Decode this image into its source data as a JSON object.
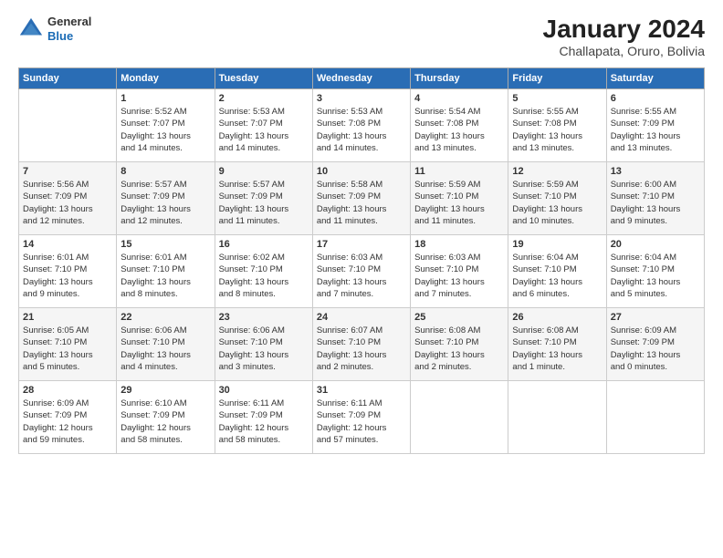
{
  "header": {
    "logo": {
      "general": "General",
      "blue": "Blue"
    },
    "title": "January 2024",
    "subtitle": "Challapata, Oruro, Bolivia"
  },
  "columns": [
    "Sunday",
    "Monday",
    "Tuesday",
    "Wednesday",
    "Thursday",
    "Friday",
    "Saturday"
  ],
  "weeks": [
    [
      {
        "day": "",
        "info": ""
      },
      {
        "day": "1",
        "info": "Sunrise: 5:52 AM\nSunset: 7:07 PM\nDaylight: 13 hours\nand 14 minutes."
      },
      {
        "day": "2",
        "info": "Sunrise: 5:53 AM\nSunset: 7:07 PM\nDaylight: 13 hours\nand 14 minutes."
      },
      {
        "day": "3",
        "info": "Sunrise: 5:53 AM\nSunset: 7:08 PM\nDaylight: 13 hours\nand 14 minutes."
      },
      {
        "day": "4",
        "info": "Sunrise: 5:54 AM\nSunset: 7:08 PM\nDaylight: 13 hours\nand 13 minutes."
      },
      {
        "day": "5",
        "info": "Sunrise: 5:55 AM\nSunset: 7:08 PM\nDaylight: 13 hours\nand 13 minutes."
      },
      {
        "day": "6",
        "info": "Sunrise: 5:55 AM\nSunset: 7:09 PM\nDaylight: 13 hours\nand 13 minutes."
      }
    ],
    [
      {
        "day": "7",
        "info": "Sunrise: 5:56 AM\nSunset: 7:09 PM\nDaylight: 13 hours\nand 12 minutes."
      },
      {
        "day": "8",
        "info": "Sunrise: 5:57 AM\nSunset: 7:09 PM\nDaylight: 13 hours\nand 12 minutes."
      },
      {
        "day": "9",
        "info": "Sunrise: 5:57 AM\nSunset: 7:09 PM\nDaylight: 13 hours\nand 11 minutes."
      },
      {
        "day": "10",
        "info": "Sunrise: 5:58 AM\nSunset: 7:09 PM\nDaylight: 13 hours\nand 11 minutes."
      },
      {
        "day": "11",
        "info": "Sunrise: 5:59 AM\nSunset: 7:10 PM\nDaylight: 13 hours\nand 11 minutes."
      },
      {
        "day": "12",
        "info": "Sunrise: 5:59 AM\nSunset: 7:10 PM\nDaylight: 13 hours\nand 10 minutes."
      },
      {
        "day": "13",
        "info": "Sunrise: 6:00 AM\nSunset: 7:10 PM\nDaylight: 13 hours\nand 9 minutes."
      }
    ],
    [
      {
        "day": "14",
        "info": "Sunrise: 6:01 AM\nSunset: 7:10 PM\nDaylight: 13 hours\nand 9 minutes."
      },
      {
        "day": "15",
        "info": "Sunrise: 6:01 AM\nSunset: 7:10 PM\nDaylight: 13 hours\nand 8 minutes."
      },
      {
        "day": "16",
        "info": "Sunrise: 6:02 AM\nSunset: 7:10 PM\nDaylight: 13 hours\nand 8 minutes."
      },
      {
        "day": "17",
        "info": "Sunrise: 6:03 AM\nSunset: 7:10 PM\nDaylight: 13 hours\nand 7 minutes."
      },
      {
        "day": "18",
        "info": "Sunrise: 6:03 AM\nSunset: 7:10 PM\nDaylight: 13 hours\nand 7 minutes."
      },
      {
        "day": "19",
        "info": "Sunrise: 6:04 AM\nSunset: 7:10 PM\nDaylight: 13 hours\nand 6 minutes."
      },
      {
        "day": "20",
        "info": "Sunrise: 6:04 AM\nSunset: 7:10 PM\nDaylight: 13 hours\nand 5 minutes."
      }
    ],
    [
      {
        "day": "21",
        "info": "Sunrise: 6:05 AM\nSunset: 7:10 PM\nDaylight: 13 hours\nand 5 minutes."
      },
      {
        "day": "22",
        "info": "Sunrise: 6:06 AM\nSunset: 7:10 PM\nDaylight: 13 hours\nand 4 minutes."
      },
      {
        "day": "23",
        "info": "Sunrise: 6:06 AM\nSunset: 7:10 PM\nDaylight: 13 hours\nand 3 minutes."
      },
      {
        "day": "24",
        "info": "Sunrise: 6:07 AM\nSunset: 7:10 PM\nDaylight: 13 hours\nand 2 minutes."
      },
      {
        "day": "25",
        "info": "Sunrise: 6:08 AM\nSunset: 7:10 PM\nDaylight: 13 hours\nand 2 minutes."
      },
      {
        "day": "26",
        "info": "Sunrise: 6:08 AM\nSunset: 7:10 PM\nDaylight: 13 hours\nand 1 minute."
      },
      {
        "day": "27",
        "info": "Sunrise: 6:09 AM\nSunset: 7:09 PM\nDaylight: 13 hours\nand 0 minutes."
      }
    ],
    [
      {
        "day": "28",
        "info": "Sunrise: 6:09 AM\nSunset: 7:09 PM\nDaylight: 12 hours\nand 59 minutes."
      },
      {
        "day": "29",
        "info": "Sunrise: 6:10 AM\nSunset: 7:09 PM\nDaylight: 12 hours\nand 58 minutes."
      },
      {
        "day": "30",
        "info": "Sunrise: 6:11 AM\nSunset: 7:09 PM\nDaylight: 12 hours\nand 58 minutes."
      },
      {
        "day": "31",
        "info": "Sunrise: 6:11 AM\nSunset: 7:09 PM\nDaylight: 12 hours\nand 57 minutes."
      },
      {
        "day": "",
        "info": ""
      },
      {
        "day": "",
        "info": ""
      },
      {
        "day": "",
        "info": ""
      }
    ]
  ]
}
